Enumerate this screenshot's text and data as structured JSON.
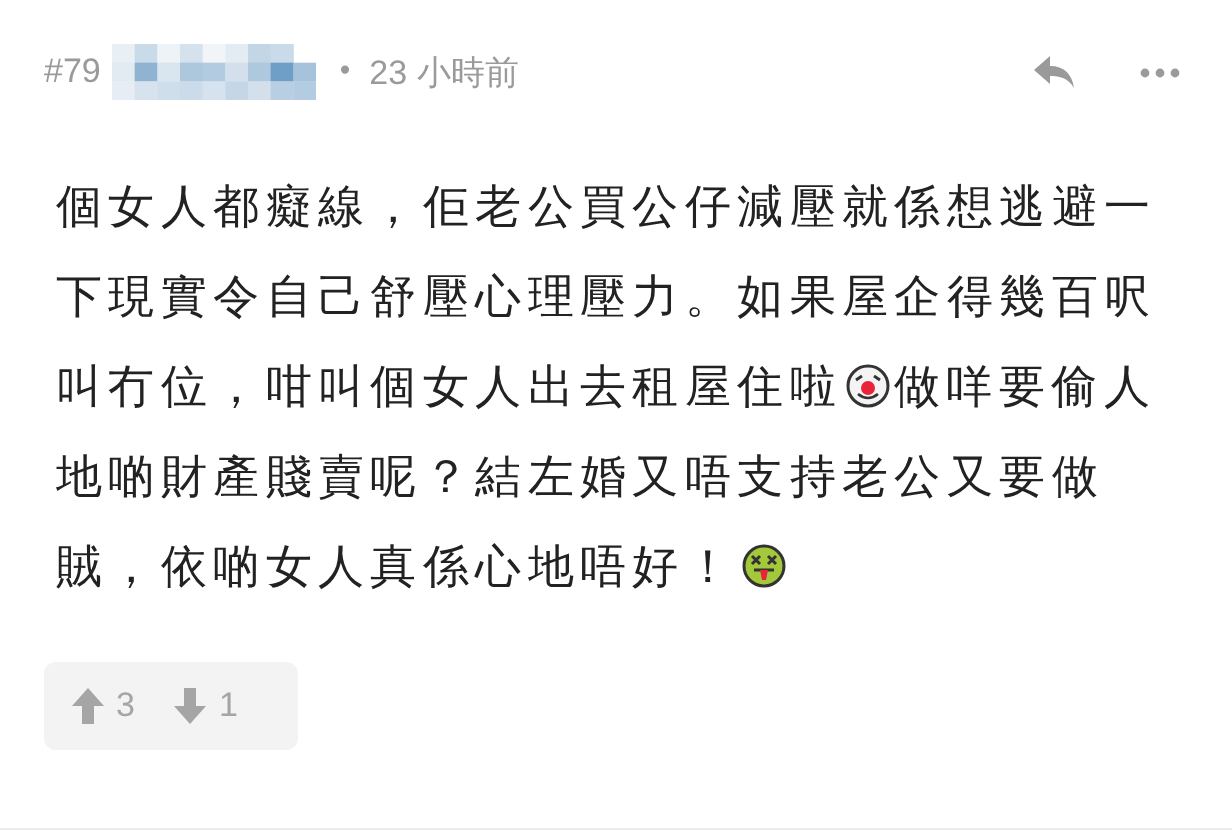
{
  "post": {
    "number": "#79",
    "separator": "•",
    "time": "23 小時前"
  },
  "body": [
    [
      {
        "kind": "text",
        "text": "個女人都癡線，佢老公買公仔減壓就係想逃避一"
      }
    ],
    [
      {
        "kind": "text",
        "text": "下現實令自己舒壓心理壓力。如果屋企得幾百呎"
      }
    ],
    [
      {
        "kind": "text",
        "text": "叫冇位，咁叫個女人出去租屋住啦"
      },
      {
        "kind": "clown"
      },
      {
        "kind": "text",
        "text": "做咩要偷人"
      }
    ],
    [
      {
        "kind": "text",
        "text": "地啲財產賤賣呢？結左婚又唔支持老公又要做"
      }
    ],
    [
      {
        "kind": "text",
        "text": "賊，依啲女人真係心地唔好！"
      },
      {
        "kind": "sick"
      }
    ]
  ],
  "votes": {
    "up": "3",
    "down": "1"
  }
}
